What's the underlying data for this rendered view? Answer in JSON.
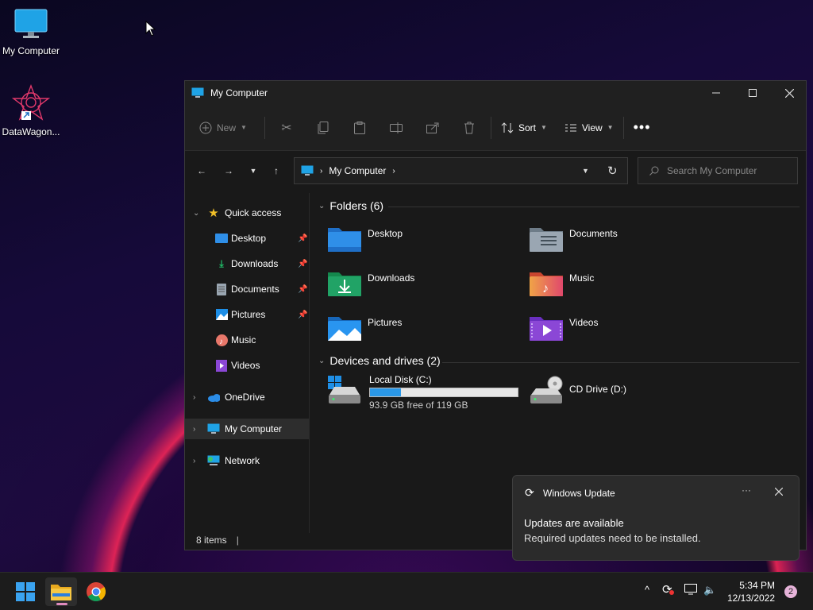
{
  "desktop": {
    "icons": [
      {
        "label": "My Computer",
        "icon": "monitor-icon"
      },
      {
        "label": "DataWagon...",
        "icon": "shortcut-app-icon"
      }
    ]
  },
  "window": {
    "title": "My Computer",
    "toolbar": {
      "new_label": "New",
      "sort_label": "Sort",
      "view_label": "View"
    },
    "address": {
      "crumb": "My Computer"
    },
    "search": {
      "placeholder": "Search My Computer"
    },
    "sidebar": {
      "quick_access": "Quick access",
      "items": [
        {
          "label": "Desktop",
          "icon": "desktop-folder-icon",
          "pinned": true
        },
        {
          "label": "Downloads",
          "icon": "download-icon",
          "pinned": true
        },
        {
          "label": "Documents",
          "icon": "document-icon",
          "pinned": true
        },
        {
          "label": "Pictures",
          "icon": "pictures-icon",
          "pinned": true
        },
        {
          "label": "Music",
          "icon": "music-icon",
          "pinned": false
        },
        {
          "label": "Videos",
          "icon": "videos-icon",
          "pinned": false
        }
      ],
      "onedrive": "OneDrive",
      "mycomputer": "My Computer",
      "network": "Network"
    },
    "folders_section": "Folders (6)",
    "folders": [
      {
        "name": "Desktop",
        "icon": "desktop-folder-icon"
      },
      {
        "name": "Documents",
        "icon": "documents-folder-icon"
      },
      {
        "name": "Downloads",
        "icon": "downloads-folder-icon"
      },
      {
        "name": "Music",
        "icon": "music-folder-icon"
      },
      {
        "name": "Pictures",
        "icon": "pictures-folder-icon"
      },
      {
        "name": "Videos",
        "icon": "videos-folder-icon"
      }
    ],
    "drives_section": "Devices and drives (2)",
    "drives": [
      {
        "name": "Local Disk (C:)",
        "free": "93.9 GB free of 119 GB",
        "used_fraction": 0.21,
        "icon": "local-disk-icon"
      },
      {
        "name": "CD Drive (D:)",
        "icon": "cd-drive-icon"
      }
    ],
    "status": "8 items"
  },
  "toast": {
    "app": "Windows Update",
    "heading": "Updates are available",
    "body": "Required updates need to be installed.",
    "more": "···"
  },
  "taskbar": {
    "time": "5:34 PM",
    "date": "12/13/2022",
    "notifications": "2"
  },
  "colors": {
    "accent": "#0078d4",
    "folder_blue": "#2f8fe8",
    "folder_green": "#21a366"
  }
}
